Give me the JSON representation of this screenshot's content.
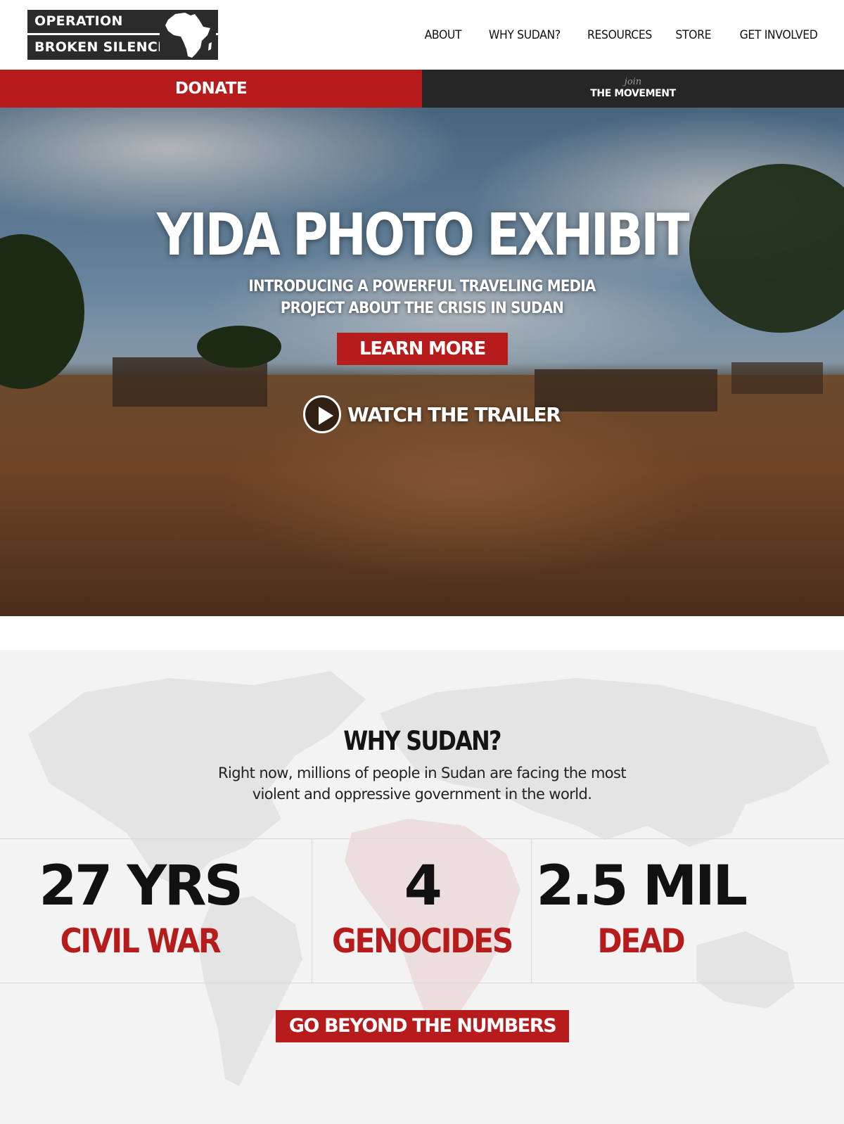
{
  "logo": {
    "line1": "OPERATION",
    "line2": "BROKEN SILENCE"
  },
  "nav": {
    "items": [
      "ABOUT",
      "WHY SUDAN?",
      "RESOURCES",
      "STORE",
      "GET INVOLVED"
    ]
  },
  "actions": {
    "donate_label": "DONATE",
    "join_script": "join",
    "join_label": "THE MOVEMENT"
  },
  "hero": {
    "title": "YIDA PHOTO EXHIBIT",
    "subtitle_line1": "INTRODUCING A POWERFUL TRAVELING MEDIA",
    "subtitle_line2": "PROJECT ABOUT THE CRISIS IN SUDAN",
    "learn_more_label": "LEARN MORE",
    "trailer_label": "WATCH THE TRAILER"
  },
  "why": {
    "title": "WHY SUDAN?",
    "text_line1": "Right now, millions of people in Sudan are facing the most",
    "text_line2": "violent and oppressive government in the world.",
    "stats": [
      {
        "value": "27 YRS",
        "label": "CIVIL WAR"
      },
      {
        "value": "4",
        "label": "GENOCIDES"
      },
      {
        "value": "2.5 MIL",
        "label": "DEAD"
      }
    ],
    "button_label": "GO BEYOND THE NUMBERS"
  },
  "colors": {
    "accent_red": "#b71c1c",
    "dark_bar": "#262626",
    "section_bg": "#f3f3f3"
  },
  "icons": {
    "play": "play-circle-icon",
    "logo_mark": "africa-icon"
  }
}
